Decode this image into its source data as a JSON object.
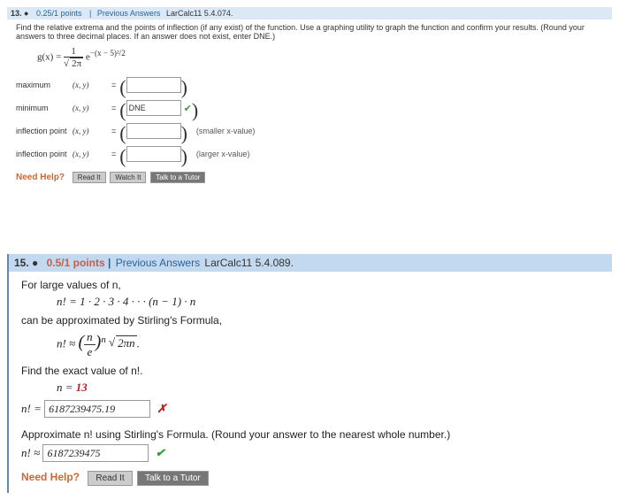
{
  "q13": {
    "header": {
      "num": "13.",
      "pts": "0.25/1 points",
      "sep": "|",
      "prev": "Previous Answers",
      "ref": "LarCalc11 5.4.074."
    },
    "instr": "Find the relative extrema and the points of inflection (if any exist) of the function. Use a graphing utility to graph the function and confirm your results. (Round your answers to three decimal places. If an answer does not exist, enter DNE.)",
    "formula": "g(x) = (1 / √(2π)) e^(−(x − 5)² / 2)",
    "rows": {
      "max": {
        "lbl": "maximum",
        "xy": "(x, y)",
        "val": ""
      },
      "min": {
        "lbl": "minimum",
        "xy": "(x, y)",
        "val": "DNE",
        "check": "✔"
      },
      "ip1": {
        "lbl": "inflection point",
        "xy": "(x, y)",
        "val": "",
        "hint": "(smaller x-value)"
      },
      "ip2": {
        "lbl": "inflection point",
        "xy": "(x, y)",
        "val": "",
        "hint": "(larger x-value)"
      }
    },
    "help": {
      "label": "Need Help?",
      "read": "Read It",
      "watch": "Watch It",
      "talk": "Talk to a Tutor"
    }
  },
  "q15": {
    "header": {
      "num": "15.",
      "pts": "0.5/1 points",
      "sep": "|",
      "prev": "Previous Answers",
      "ref": "LarCalc11 5.4.089."
    },
    "line1": "For large values of n,",
    "math1": "n! = 1 · 2 · 3 · 4 · · · (n − 1) · n",
    "line2": "can be approximated by Stirling's Formula,",
    "math2": "n! ≈ (n / e)ⁿ √(2πn).",
    "line3": "Find the exact value of n!.",
    "nline": "n = ",
    "nval": "13",
    "exact_lhs": "n! = ",
    "exact_val": "6187239475.19",
    "approx_instr": "Approximate n! using Stirling's Formula. (Round your answer to the nearest whole number.)",
    "approx_lhs": "n! ≈ ",
    "approx_val": "6187239475",
    "help": {
      "label": "Need Help?",
      "read": "Read It",
      "talk": "Talk to a Tutor"
    }
  }
}
